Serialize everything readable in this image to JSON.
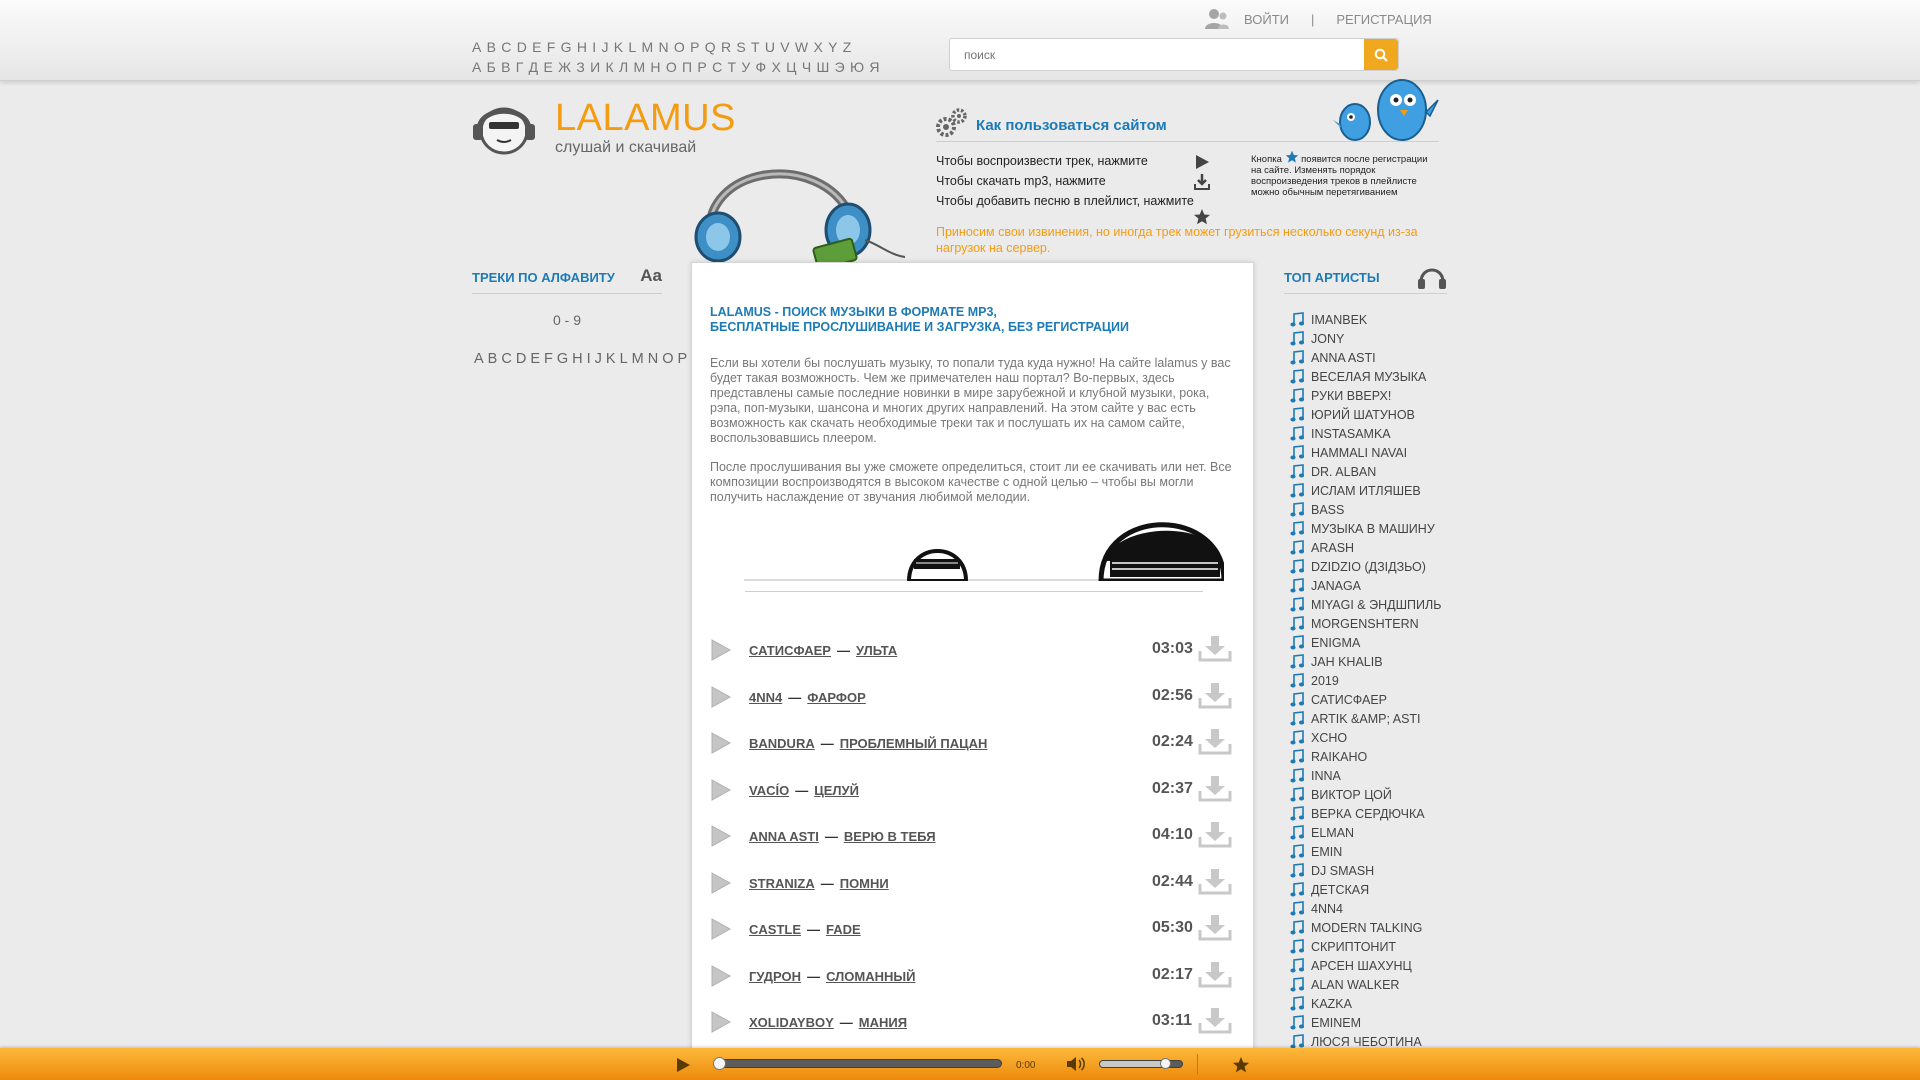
{
  "header": {
    "latin_letters": [
      "A",
      "B",
      "C",
      "D",
      "E",
      "F",
      "G",
      "H",
      "I",
      "J",
      "K",
      "L",
      "M",
      "N",
      "O",
      "P",
      "Q",
      "R",
      "S",
      "T",
      "U",
      "V",
      "W",
      "X",
      "Y",
      "Z"
    ],
    "cyrillic_letters": [
      "А",
      "Б",
      "В",
      "Г",
      "Д",
      "Е",
      "Ж",
      "З",
      "И",
      "К",
      "Л",
      "М",
      "Н",
      "О",
      "П",
      "Р",
      "С",
      "Т",
      "У",
      "Ф",
      "Х",
      "Ц",
      "Ч",
      "Ш",
      "Э",
      "Ю",
      "Я"
    ],
    "login_label": "ВОЙТИ",
    "separator": "|",
    "register_label": "РЕГИСТРАЦИЯ",
    "search_placeholder": "поиск"
  },
  "logo": {
    "title": "LALAMUS",
    "subtitle": "слушай и скачивай"
  },
  "howto": {
    "title": "Как пользоваться сайтом",
    "line_play": "Чтобы воспроизвести трек, нажмите",
    "line_download": "Чтобы скачать mp3, нажмите",
    "line_playlist": "Чтобы добавить песню в плейлист, нажмите",
    "note_prefix": "Кнопка",
    "note_text": "появится после регистрации на сайте. Изменять порядок воспроизведения треков в плейлисте можно обычным перетягиванием",
    "apology": "Приносим свои извинения, но иногда трек может грузиться несколько секунд из-за нагрузок на сервер."
  },
  "left": {
    "title": "ТРЕКИ ПО АЛФАВИТУ",
    "font_toggle": "Aa",
    "digits": "0 - 9"
  },
  "center": {
    "title_line1": "LALAMUS - ПОИСК МУЗЫКИ В ФОРМАТЕ MP3,",
    "title_line2": "БЕСПЛАТНЫЕ ПРОСЛУШИВАНИЕ И ЗАГРУЗКА, БЕЗ РЕГИСТРАЦИИ",
    "paragraph1": "Если вы хотели бы послушать музыку, то попали туда куда нужно! На сайте lalamus у вас будет такая возможность. Чем же примечателен наш портал? Во-первых, здесь представлены самые последние новинки в мире зарубежной и клубной музыки, рока, рэпа, поп-музыки, шансона и многих других направлений. На этом сайте у вас есть возможность как скачать необходимые треки так и послушать их на самом сайте, воспользовавшись плеером.",
    "paragraph2": "После прослушивания вы уже сможете определиться, стоит ли ее скачивать или нет. Все композиции воспроизводятся в высоком качестве с одной целью – чтобы вы могли получить наслаждение от звучания любимой мелодии.",
    "dash": "—",
    "tracks": [
      {
        "artist": "САТИСФАЕР",
        "title": "УЛЬТА",
        "duration": "03:03"
      },
      {
        "artist": "4NN4",
        "title": "ФАРФОР",
        "duration": "02:56"
      },
      {
        "artist": "BANDURA",
        "title": "ПРОБЛЕМНЫЙ ПАЦАН",
        "duration": "02:24"
      },
      {
        "artist": "VACÍO",
        "title": "ЦЕЛУЙ",
        "duration": "02:37"
      },
      {
        "artist": "ANNA ASTI",
        "title": "ВЕРЮ В ТЕБЯ",
        "duration": "04:10"
      },
      {
        "artist": "STRANIZA",
        "title": "ПОМНИ",
        "duration": "02:44"
      },
      {
        "artist": "CASTLE",
        "title": "FADE",
        "duration": "05:30"
      },
      {
        "artist": "ГУДРОН",
        "title": "СЛОМАННЫЙ",
        "duration": "02:17"
      },
      {
        "artist": "XOLIDAYBOY",
        "title": "МАНИЯ",
        "duration": "03:11"
      }
    ]
  },
  "right": {
    "title": "ТОП АРТИСТЫ",
    "artists": [
      "IMANBEK",
      "JONY",
      "ANNA ASTI",
      "ВЕСЕЛАЯ МУЗЫКА",
      "РУКИ ВВЕРХ!",
      "ЮРИЙ ШАТУНОВ",
      "INSTASAMKA",
      "HAMMALI NAVAI",
      "DR. ALBAN",
      "ИСЛАМ ИТЛЯШЕВ",
      "BASS",
      "МУЗЫКА В МАШИНУ",
      "ARASH",
      "DZIDZIO (ДЗІДЗЬО)",
      "JANAGA",
      "MIYAGI & ЭНДШПИЛЬ",
      "MORGENSHTERN",
      "ENIGMA",
      "JAH KHALIB",
      "2019",
      "САТИСФАЕР",
      "ARTIK &AMP; ASTI",
      "XCHO",
      "RAIKAHO",
      "INNA",
      "ВИКТОР ЦОЙ",
      "ВЕРКА СЕРДЮЧКА",
      "ELMAN",
      "EMIN",
      "DJ SMASH",
      "ДЕТСКАЯ",
      "4NN4",
      "MODERN TALKING",
      "СКРИПТОНИТ",
      "АРСЕН ШАХУНЦ",
      "ALAN WALKER",
      "KAZKA",
      "EMINEM",
      "ЛЮСЯ ЧЕБОТИНА"
    ]
  },
  "player": {
    "time": "0:00",
    "progress": 0,
    "volume": 0.8
  },
  "colors": {
    "accent": "#f39c12",
    "link_blue": "#1c7bb7",
    "player_bar": "#f7a322"
  }
}
